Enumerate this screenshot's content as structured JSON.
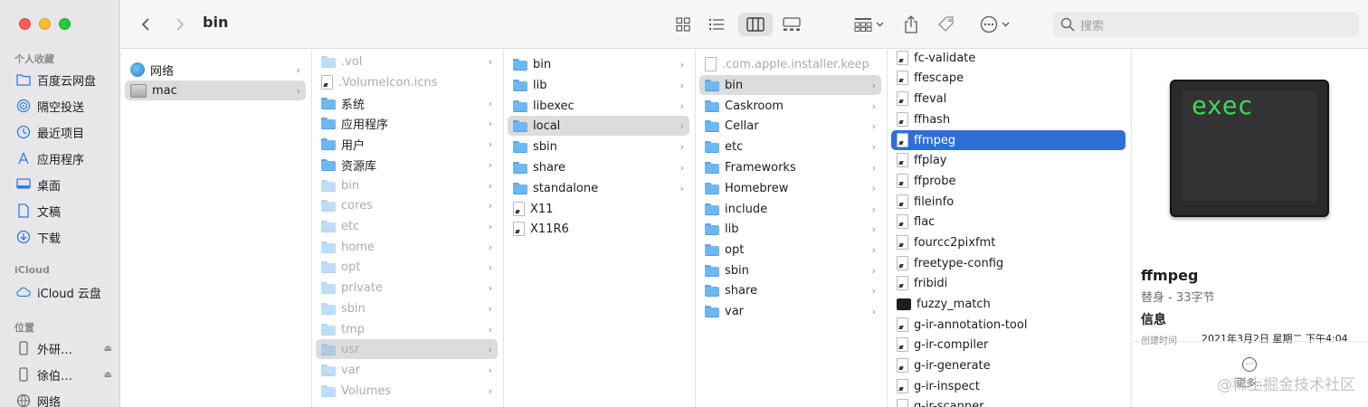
{
  "window": {
    "title": "bin"
  },
  "sidebar": {
    "sections": [
      {
        "label": "个人收藏",
        "items": [
          {
            "label": "百度云网盘",
            "icon": "folder-icon"
          },
          {
            "label": "隔空投送",
            "icon": "airdrop-icon"
          },
          {
            "label": "最近项目",
            "icon": "clock-icon"
          },
          {
            "label": "应用程序",
            "icon": "apps-icon"
          },
          {
            "label": "桌面",
            "icon": "desktop-icon"
          },
          {
            "label": "文稿",
            "icon": "document-icon"
          },
          {
            "label": "下载",
            "icon": "download-icon"
          }
        ]
      },
      {
        "label": "iCloud",
        "items": [
          {
            "label": "iCloud 云盘",
            "icon": "cloud-icon"
          }
        ]
      },
      {
        "label": "位置",
        "items": [
          {
            "label": "外研…",
            "icon": "device-icon"
          },
          {
            "label": "徐伯…",
            "icon": "device-icon"
          },
          {
            "label": "网络",
            "icon": "globe-icon"
          }
        ]
      }
    ]
  },
  "toolbar": {
    "back": "‹",
    "forward": "›",
    "search_placeholder": "搜索"
  },
  "columns": [
    {
      "rows": [
        {
          "name": "网络",
          "type": "globe",
          "chevron": true
        },
        {
          "name": "mac",
          "type": "disk",
          "chevron": true,
          "state": "sel"
        }
      ]
    },
    {
      "rows": [
        {
          "name": ".vol",
          "type": "folder",
          "dim": true,
          "chevron": true
        },
        {
          "name": ".VolumeIcon.icns",
          "type": "doc",
          "dim": true
        },
        {
          "name": "系统",
          "type": "folder",
          "chevron": true
        },
        {
          "name": "应用程序",
          "type": "folder",
          "chevron": true
        },
        {
          "name": "用户",
          "type": "folder",
          "chevron": true
        },
        {
          "name": "资源库",
          "type": "folder",
          "chevron": true
        },
        {
          "name": "bin",
          "type": "folder",
          "dim": true,
          "chevron": true
        },
        {
          "name": "cores",
          "type": "folder",
          "dim": true,
          "chevron": true
        },
        {
          "name": "etc",
          "type": "folder",
          "dim": true,
          "chevron": true
        },
        {
          "name": "home",
          "type": "folder",
          "dim": true,
          "chevron": true
        },
        {
          "name": "opt",
          "type": "folder",
          "dim": true,
          "chevron": true
        },
        {
          "name": "private",
          "type": "folder",
          "dim": true,
          "chevron": true
        },
        {
          "name": "sbin",
          "type": "folder",
          "dim": true,
          "chevron": true
        },
        {
          "name": "tmp",
          "type": "folder",
          "dim": true,
          "chevron": true
        },
        {
          "name": "usr",
          "type": "folder",
          "dim": true,
          "chevron": true,
          "state": "sel"
        },
        {
          "name": "var",
          "type": "folder",
          "dim": true,
          "chevron": true
        },
        {
          "name": "Volumes",
          "type": "folder",
          "dim": true,
          "chevron": true
        }
      ]
    },
    {
      "rows": [
        {
          "name": "bin",
          "type": "folder",
          "chevron": true
        },
        {
          "name": "lib",
          "type": "folder",
          "chevron": true
        },
        {
          "name": "libexec",
          "type": "folder",
          "chevron": true
        },
        {
          "name": "local",
          "type": "folder",
          "chevron": true,
          "state": "sel"
        },
        {
          "name": "sbin",
          "type": "folder",
          "chevron": true
        },
        {
          "name": "share",
          "type": "folder",
          "chevron": true
        },
        {
          "name": "standalone",
          "type": "folder",
          "chevron": true
        },
        {
          "name": "X11",
          "type": "doc"
        },
        {
          "name": "X11R6",
          "type": "doc"
        }
      ]
    },
    {
      "rows": [
        {
          "name": ".com.apple.installer.keep",
          "type": "doc-blank",
          "dim": true
        },
        {
          "name": "bin",
          "type": "folder",
          "chevron": true,
          "state": "sel"
        },
        {
          "name": "Caskroom",
          "type": "folder",
          "chevron": true
        },
        {
          "name": "Cellar",
          "type": "folder",
          "chevron": true
        },
        {
          "name": "etc",
          "type": "folder",
          "chevron": true
        },
        {
          "name": "Frameworks",
          "type": "folder",
          "chevron": true
        },
        {
          "name": "Homebrew",
          "type": "folder",
          "chevron": true
        },
        {
          "name": "include",
          "type": "folder",
          "chevron": true
        },
        {
          "name": "lib",
          "type": "folder",
          "chevron": true
        },
        {
          "name": "opt",
          "type": "folder",
          "chevron": true
        },
        {
          "name": "sbin",
          "type": "folder",
          "chevron": true
        },
        {
          "name": "share",
          "type": "folder",
          "chevron": true
        },
        {
          "name": "var",
          "type": "folder",
          "chevron": true
        }
      ]
    },
    {
      "rows": [
        {
          "name": "fc-validate",
          "type": "doc"
        },
        {
          "name": "ffescape",
          "type": "doc"
        },
        {
          "name": "ffeval",
          "type": "doc"
        },
        {
          "name": "ffhash",
          "type": "doc"
        },
        {
          "name": "ffmpeg",
          "type": "doc",
          "state": "hl"
        },
        {
          "name": "ffplay",
          "type": "doc"
        },
        {
          "name": "ffprobe",
          "type": "doc"
        },
        {
          "name": "fileinfo",
          "type": "doc"
        },
        {
          "name": "flac",
          "type": "doc"
        },
        {
          "name": "fourcc2pixfmt",
          "type": "doc"
        },
        {
          "name": "freetype-config",
          "type": "doc"
        },
        {
          "name": "fribidi",
          "type": "doc"
        },
        {
          "name": "fuzzy_match",
          "type": "term"
        },
        {
          "name": "g-ir-annotation-tool",
          "type": "doc"
        },
        {
          "name": "g-ir-compiler",
          "type": "doc"
        },
        {
          "name": "g-ir-generate",
          "type": "doc"
        },
        {
          "name": "g-ir-inspect",
          "type": "doc"
        },
        {
          "name": "g-ir-scanner",
          "type": "doc"
        }
      ]
    }
  ],
  "preview": {
    "icon_text": "exec",
    "name": "ffmpeg",
    "subtitle": "替身 - 33字节",
    "info_heading": "信息",
    "created_label": "创建时间",
    "created_value": "2021年3月2日 星期二 下午4:04",
    "more_label": "更多…"
  },
  "watermark": "@稀土掘金技术社区"
}
